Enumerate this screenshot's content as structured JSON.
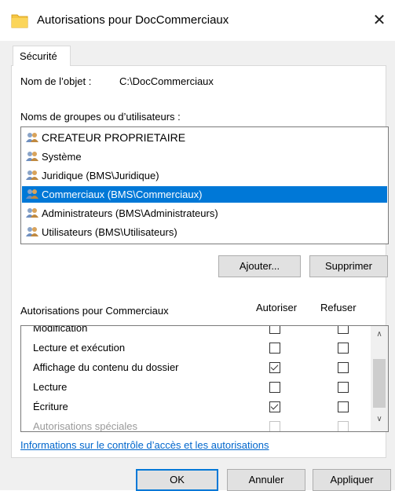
{
  "window": {
    "title": "Autorisations pour DocCommerciaux",
    "close_glyph": "✕"
  },
  "tabs": [
    {
      "label": "Sécurité"
    }
  ],
  "object": {
    "label": "Nom de l’objet :",
    "value": "C:\\DocCommerciaux"
  },
  "groups": {
    "label": "Noms de groupes ou d’utilisateurs :",
    "items": [
      {
        "name": "CREATEUR PROPRIETAIRE",
        "icon": "users-icon",
        "selected": false
      },
      {
        "name": "Système",
        "icon": "users-icon",
        "selected": false
      },
      {
        "name": "Juridique (BMS\\Juridique)",
        "icon": "users-icon",
        "selected": false
      },
      {
        "name": "Commerciaux (BMS\\Commerciaux)",
        "icon": "users-icon",
        "selected": true
      },
      {
        "name": "Administrateurs (BMS\\Administrateurs)",
        "icon": "users-icon",
        "selected": false
      },
      {
        "name": "Utilisateurs (BMS\\Utilisateurs)",
        "icon": "users-icon",
        "selected": false
      }
    ]
  },
  "group_buttons": {
    "add": "Ajouter...",
    "remove": "Supprimer"
  },
  "permissions": {
    "header": "Autorisations pour Commerciaux",
    "col_allow": "Autoriser",
    "col_deny": "Refuser",
    "rows": [
      {
        "name": "Modification",
        "allow": false,
        "deny": false
      },
      {
        "name": "Lecture et exécution",
        "allow": false,
        "deny": false
      },
      {
        "name": "Affichage du contenu du dossier",
        "allow": true,
        "deny": false
      },
      {
        "name": "Lecture",
        "allow": false,
        "deny": false
      },
      {
        "name": "Écriture",
        "allow": true,
        "deny": false
      },
      {
        "name": "Autorisations spéciales",
        "allow": false,
        "deny": false
      }
    ]
  },
  "info_link": "Informations sur le contrôle d’accès et les autorisations",
  "footer": {
    "ok": "OK",
    "cancel": "Annuler",
    "apply": "Appliquer"
  },
  "colors": {
    "accent": "#0078d7",
    "link": "#0066cc",
    "dialog_bg": "#f0f0f0",
    "folder": "#f5c542"
  }
}
